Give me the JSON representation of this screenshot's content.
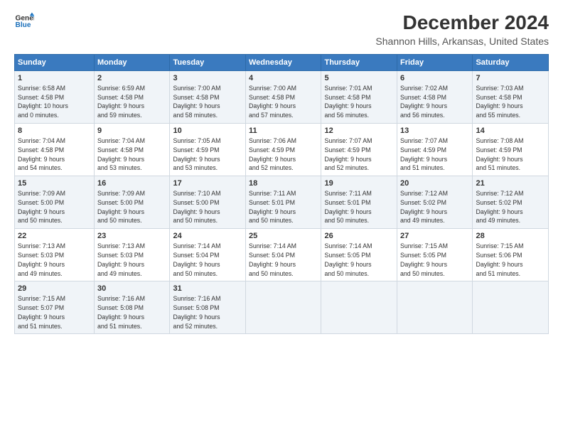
{
  "header": {
    "logo_line1": "General",
    "logo_line2": "Blue",
    "title": "December 2024",
    "subtitle": "Shannon Hills, Arkansas, United States"
  },
  "days_of_week": [
    "Sunday",
    "Monday",
    "Tuesday",
    "Wednesday",
    "Thursday",
    "Friday",
    "Saturday"
  ],
  "weeks": [
    [
      {
        "day": "1",
        "info": "Sunrise: 6:58 AM\nSunset: 4:58 PM\nDaylight: 10 hours\nand 0 minutes."
      },
      {
        "day": "2",
        "info": "Sunrise: 6:59 AM\nSunset: 4:58 PM\nDaylight: 9 hours\nand 59 minutes."
      },
      {
        "day": "3",
        "info": "Sunrise: 7:00 AM\nSunset: 4:58 PM\nDaylight: 9 hours\nand 58 minutes."
      },
      {
        "day": "4",
        "info": "Sunrise: 7:00 AM\nSunset: 4:58 PM\nDaylight: 9 hours\nand 57 minutes."
      },
      {
        "day": "5",
        "info": "Sunrise: 7:01 AM\nSunset: 4:58 PM\nDaylight: 9 hours\nand 56 minutes."
      },
      {
        "day": "6",
        "info": "Sunrise: 7:02 AM\nSunset: 4:58 PM\nDaylight: 9 hours\nand 56 minutes."
      },
      {
        "day": "7",
        "info": "Sunrise: 7:03 AM\nSunset: 4:58 PM\nDaylight: 9 hours\nand 55 minutes."
      }
    ],
    [
      {
        "day": "8",
        "info": "Sunrise: 7:04 AM\nSunset: 4:58 PM\nDaylight: 9 hours\nand 54 minutes."
      },
      {
        "day": "9",
        "info": "Sunrise: 7:04 AM\nSunset: 4:58 PM\nDaylight: 9 hours\nand 53 minutes."
      },
      {
        "day": "10",
        "info": "Sunrise: 7:05 AM\nSunset: 4:59 PM\nDaylight: 9 hours\nand 53 minutes."
      },
      {
        "day": "11",
        "info": "Sunrise: 7:06 AM\nSunset: 4:59 PM\nDaylight: 9 hours\nand 52 minutes."
      },
      {
        "day": "12",
        "info": "Sunrise: 7:07 AM\nSunset: 4:59 PM\nDaylight: 9 hours\nand 52 minutes."
      },
      {
        "day": "13",
        "info": "Sunrise: 7:07 AM\nSunset: 4:59 PM\nDaylight: 9 hours\nand 51 minutes."
      },
      {
        "day": "14",
        "info": "Sunrise: 7:08 AM\nSunset: 4:59 PM\nDaylight: 9 hours\nand 51 minutes."
      }
    ],
    [
      {
        "day": "15",
        "info": "Sunrise: 7:09 AM\nSunset: 5:00 PM\nDaylight: 9 hours\nand 50 minutes."
      },
      {
        "day": "16",
        "info": "Sunrise: 7:09 AM\nSunset: 5:00 PM\nDaylight: 9 hours\nand 50 minutes."
      },
      {
        "day": "17",
        "info": "Sunrise: 7:10 AM\nSunset: 5:00 PM\nDaylight: 9 hours\nand 50 minutes."
      },
      {
        "day": "18",
        "info": "Sunrise: 7:11 AM\nSunset: 5:01 PM\nDaylight: 9 hours\nand 50 minutes."
      },
      {
        "day": "19",
        "info": "Sunrise: 7:11 AM\nSunset: 5:01 PM\nDaylight: 9 hours\nand 50 minutes."
      },
      {
        "day": "20",
        "info": "Sunrise: 7:12 AM\nSunset: 5:02 PM\nDaylight: 9 hours\nand 49 minutes."
      },
      {
        "day": "21",
        "info": "Sunrise: 7:12 AM\nSunset: 5:02 PM\nDaylight: 9 hours\nand 49 minutes."
      }
    ],
    [
      {
        "day": "22",
        "info": "Sunrise: 7:13 AM\nSunset: 5:03 PM\nDaylight: 9 hours\nand 49 minutes."
      },
      {
        "day": "23",
        "info": "Sunrise: 7:13 AM\nSunset: 5:03 PM\nDaylight: 9 hours\nand 49 minutes."
      },
      {
        "day": "24",
        "info": "Sunrise: 7:14 AM\nSunset: 5:04 PM\nDaylight: 9 hours\nand 50 minutes."
      },
      {
        "day": "25",
        "info": "Sunrise: 7:14 AM\nSunset: 5:04 PM\nDaylight: 9 hours\nand 50 minutes."
      },
      {
        "day": "26",
        "info": "Sunrise: 7:14 AM\nSunset: 5:05 PM\nDaylight: 9 hours\nand 50 minutes."
      },
      {
        "day": "27",
        "info": "Sunrise: 7:15 AM\nSunset: 5:05 PM\nDaylight: 9 hours\nand 50 minutes."
      },
      {
        "day": "28",
        "info": "Sunrise: 7:15 AM\nSunset: 5:06 PM\nDaylight: 9 hours\nand 51 minutes."
      }
    ],
    [
      {
        "day": "29",
        "info": "Sunrise: 7:15 AM\nSunset: 5:07 PM\nDaylight: 9 hours\nand 51 minutes."
      },
      {
        "day": "30",
        "info": "Sunrise: 7:16 AM\nSunset: 5:08 PM\nDaylight: 9 hours\nand 51 minutes."
      },
      {
        "day": "31",
        "info": "Sunrise: 7:16 AM\nSunset: 5:08 PM\nDaylight: 9 hours\nand 52 minutes."
      },
      {
        "day": "",
        "info": ""
      },
      {
        "day": "",
        "info": ""
      },
      {
        "day": "",
        "info": ""
      },
      {
        "day": "",
        "info": ""
      }
    ]
  ]
}
